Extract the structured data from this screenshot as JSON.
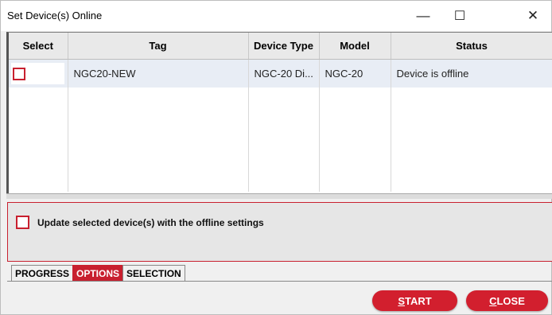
{
  "window": {
    "title": "Set Device(s) Online"
  },
  "titlebar_buttons": {
    "minimize": "—",
    "maximize": "☐",
    "close": "✕"
  },
  "table": {
    "headers": [
      "Select",
      "Tag",
      "Device Type",
      "Model",
      "Status"
    ],
    "rows": [
      {
        "selected": false,
        "tag": "NGC20-NEW",
        "device_type": "NGC-20 Di...",
        "model": "NGC-20",
        "status": "Device is offline"
      }
    ]
  },
  "options": {
    "update_label": "Update selected device(s) with the offline settings",
    "update_checked": false
  },
  "tabs": [
    "PROGRESS",
    "OPTIONS",
    "SELECTION"
  ],
  "active_tab": "OPTIONS",
  "buttons": {
    "start_first": "S",
    "start_rest": "TART",
    "close_first": "C",
    "close_rest": "LOSE"
  },
  "colors": {
    "accent": "#c8202f",
    "button": "#d21f2e"
  }
}
